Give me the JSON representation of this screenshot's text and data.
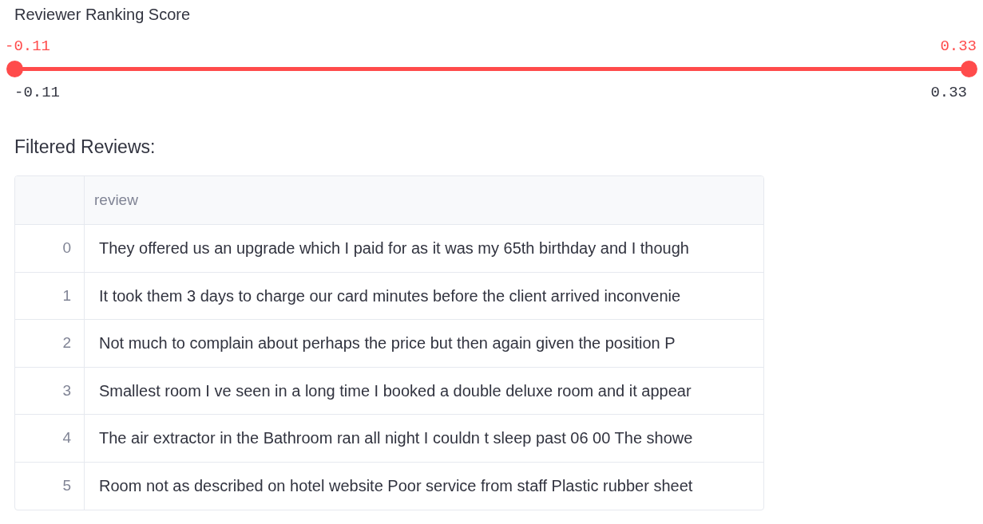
{
  "slider": {
    "label": "Reviewer Ranking Score",
    "thumbs": [
      {
        "value": "-0.11",
        "level": 0
      },
      {
        "value": "0.33",
        "level": 1
      }
    ],
    "min": "-0.11",
    "max": "0.33"
  },
  "section_title": "Filtered Reviews:",
  "table": {
    "columns": [
      "review"
    ],
    "rows": [
      {
        "index": "0",
        "review": "They offered us an upgrade which I paid for as it was my 65th birthday and I though"
      },
      {
        "index": "1",
        "review": "It took them 3 days to charge our card minutes before the client arrived inconvenie"
      },
      {
        "index": "2",
        "review": "Not much to complain about perhaps the price but then again given the position  P"
      },
      {
        "index": "3",
        "review": "Smallest room I ve seen in a long time I booked a double deluxe room and it appear"
      },
      {
        "index": "4",
        "review": "The air extractor in the Bathroom ran all night I couldn t sleep past 06 00 The showe"
      },
      {
        "index": "5",
        "review": "Room not as described on hotel website Poor service from staff Plastic rubber sheet"
      }
    ]
  }
}
